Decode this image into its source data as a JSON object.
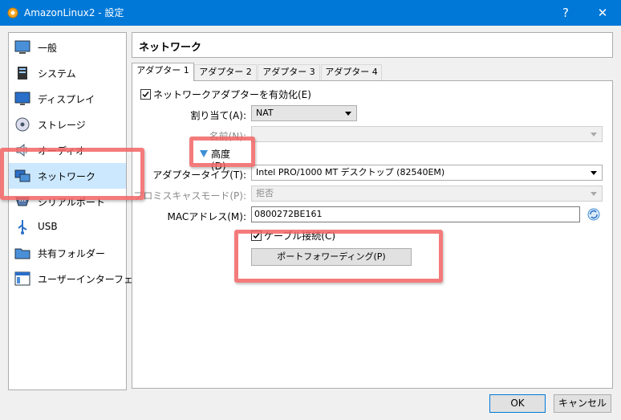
{
  "window": {
    "title": "AmazonLinux2 - 設定",
    "help_label": "?",
    "close_label": "✕"
  },
  "sidebar": {
    "items": [
      {
        "label": "一般",
        "icon": "general-icon"
      },
      {
        "label": "システム",
        "icon": "system-icon"
      },
      {
        "label": "ディスプレイ",
        "icon": "display-icon"
      },
      {
        "label": "ストレージ",
        "icon": "storage-icon"
      },
      {
        "label": "オーディオ",
        "icon": "audio-icon"
      },
      {
        "label": "ネットワーク",
        "icon": "network-icon",
        "selected": true
      },
      {
        "label": "シリアルポート",
        "icon": "serial-port-icon"
      },
      {
        "label": "USB",
        "icon": "usb-icon"
      },
      {
        "label": "共有フォルダー",
        "icon": "shared-folder-icon"
      },
      {
        "label": "ユーザーインターフェース",
        "icon": "user-interface-icon"
      }
    ]
  },
  "panel": {
    "title": "ネットワーク",
    "tabs": [
      {
        "label": "アダプター 1",
        "active": true
      },
      {
        "label": "アダプター 2"
      },
      {
        "label": "アダプター 3"
      },
      {
        "label": "アダプター 4"
      }
    ],
    "enable_adapter": {
      "label": "ネットワークアダプターを有効化(E)",
      "checked": true
    },
    "attached_to": {
      "label": "割り当て(A):",
      "value": "NAT"
    },
    "name": {
      "label": "名前(N):",
      "value": ""
    },
    "advanced": {
      "label": "高度(D)"
    },
    "adapter_type": {
      "label": "アダプタータイプ(T):",
      "value": "Intel PRO/1000 MT デスクトップ (82540EM)"
    },
    "promiscuous": {
      "label": "プロミスキャスモード(P):",
      "value": "拒否"
    },
    "mac": {
      "label": "MACアドレス(M):",
      "value": "0800272BE161"
    },
    "cable": {
      "label": "ケーブル接続(C)",
      "checked": true
    },
    "port_forwarding": {
      "label": "ポートフォワーディング(P)"
    }
  },
  "footer": {
    "ok_label": "OK",
    "cancel_label": "キャンセル"
  },
  "colors": {
    "titlebar": "#0078d7",
    "selection": "#cce8ff",
    "highlight": "#f26464"
  }
}
